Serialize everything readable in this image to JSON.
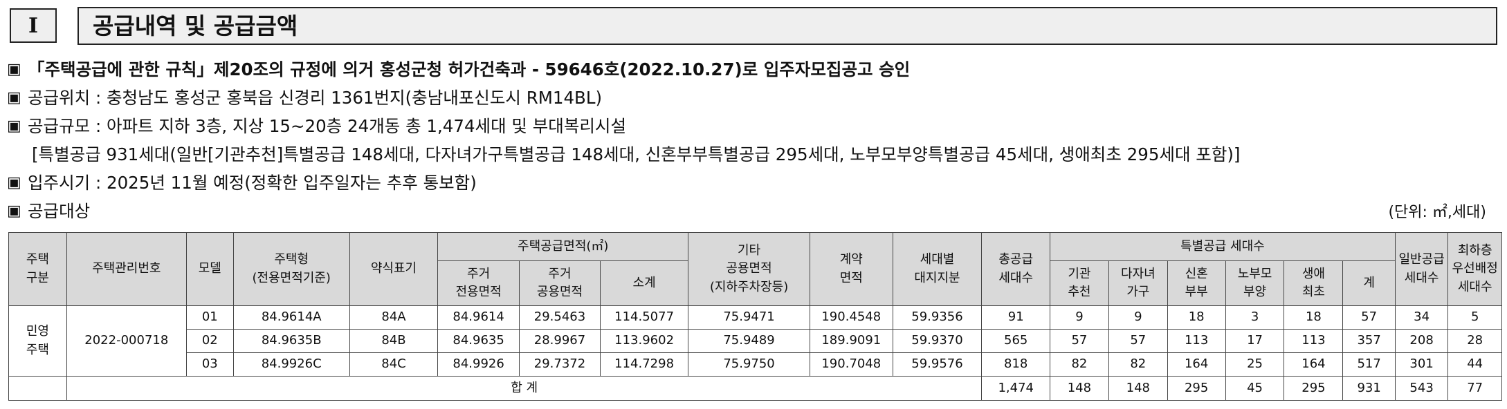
{
  "header": {
    "section_no": "I",
    "title": "공급내역 및 공급금액"
  },
  "info": {
    "bullet": "▣",
    "approval": "「주택공급에 관한 규칙」제20조의 규정에 의거 홍성군청 허가건축과 - 59646호(2022.10.27)로 입주자모집공고 승인",
    "location": "공급위치 : 충청남도 홍성군 홍북읍 신경리 1361번지(충남내포신도시 RM14BL)",
    "scale": "공급규모 : 아파트 지하 3층, 지상 15~20층 24개동 총 1,474세대 및 부대복리시설",
    "scale_detail": "[특별공급 931세대(일반[기관추천]특별공급 148세대, 다자녀가구특별공급 148세대, 신혼부부특별공급 295세대, 노부모부양특별공급 45세대, 생애최초 295세대 포함)]",
    "move_in": "입주시기 : 2025년 11월 예정(정확한 입주일자는 추후 통보함)",
    "target": "공급대상",
    "unit": "(단위: ㎡,세대)"
  },
  "table": {
    "headers": {
      "house_type_l1": "주택",
      "house_type_l2": "구분",
      "mgmt_no": "주택관리번호",
      "model": "모델",
      "house_type_name_l1": "주택형",
      "house_type_name_l2": "(전용면적기준)",
      "short": "약식표기",
      "supply_area": "주택공급면적(㎡)",
      "exclusive_l1": "주거",
      "exclusive_l2": "전용면적",
      "common_l1": "주거",
      "common_l2": "공용면적",
      "subtotal": "소계",
      "other_l1": "기타",
      "other_l2": "공용면적",
      "other_l3": "(지하주차장등)",
      "contract_l1": "계약",
      "contract_l2": "면적",
      "land_l1": "세대별",
      "land_l2": "대지지분",
      "total_supply_l1": "총공급",
      "total_supply_l2": "세대수",
      "special": "특별공급 세대수",
      "inst_l1": "기관",
      "inst_l2": "추천",
      "multi_l1": "다자녀",
      "multi_l2": "가구",
      "newly_l1": "신혼",
      "newly_l2": "부부",
      "elder_l1": "노부모",
      "elder_l2": "부양",
      "first_l1": "생애",
      "first_l2": "최초",
      "special_sum": "계",
      "general_l1": "일반공급",
      "general_l2": "세대수",
      "lowest_l1": "최하층",
      "lowest_l2": "우선배정",
      "lowest_l3": "세대수"
    },
    "group_label_l1": "민영",
    "group_label_l2": "주택",
    "mgmt_no_value": "2022-000718",
    "rows": [
      {
        "model": "01",
        "type": "84.9614A",
        "short": "84A",
        "exclusive": "84.9614",
        "common": "29.5463",
        "subtotal": "114.5077",
        "other": "75.9471",
        "contract": "190.4548",
        "land": "59.9356",
        "total": "91",
        "inst": "9",
        "multi": "9",
        "newly": "18",
        "elder": "3",
        "first": "18",
        "sum": "57",
        "general": "34",
        "lowest": "5"
      },
      {
        "model": "02",
        "type": "84.9635B",
        "short": "84B",
        "exclusive": "84.9635",
        "common": "28.9967",
        "subtotal": "113.9602",
        "other": "75.9489",
        "contract": "189.9091",
        "land": "59.9370",
        "total": "565",
        "inst": "57",
        "multi": "57",
        "newly": "113",
        "elder": "17",
        "first": "113",
        "sum": "357",
        "general": "208",
        "lowest": "28"
      },
      {
        "model": "03",
        "type": "84.9926C",
        "short": "84C",
        "exclusive": "84.9926",
        "common": "29.7372",
        "subtotal": "114.7298",
        "other": "75.9750",
        "contract": "190.7048",
        "land": "59.9576",
        "total": "818",
        "inst": "82",
        "multi": "82",
        "newly": "164",
        "elder": "25",
        "first": "164",
        "sum": "517",
        "general": "301",
        "lowest": "44"
      }
    ],
    "totals": {
      "label": "합 계",
      "total": "1,474",
      "inst": "148",
      "multi": "148",
      "newly": "295",
      "elder": "45",
      "first": "295",
      "sum": "931",
      "general": "543",
      "lowest": "77"
    }
  }
}
